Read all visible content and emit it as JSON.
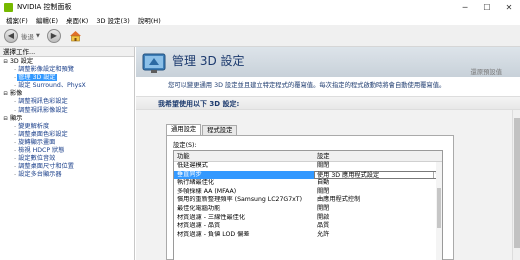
{
  "window": {
    "title": "NVIDIA 控制面板",
    "minimize_glyph": "─",
    "maximize_glyph": "☐",
    "close_glyph": "✕"
  },
  "menu": [
    "檔案(F)",
    "編輯(E)",
    "桌面(K)",
    "3D 設定(3)",
    "說明(H)"
  ],
  "toolbar": {
    "back_label": "後退",
    "back_glyph": "◀",
    "forward_glyph": "▶",
    "caret_glyph": "▼"
  },
  "left_panel": {
    "task_header": "選擇工作...",
    "tree": [
      {
        "type": "category",
        "label": "3D 設定",
        "toggle": "⊟"
      },
      {
        "type": "leaf",
        "label": "調整影像設定和預覽"
      },
      {
        "type": "leaf",
        "label": "管理 3D 設定",
        "selected": true
      },
      {
        "type": "leaf",
        "label": "設定 Surround、PhysX"
      },
      {
        "type": "category",
        "label": "影像",
        "toggle": "⊟"
      },
      {
        "type": "leaf",
        "label": "調整視訊色彩設定"
      },
      {
        "type": "leaf",
        "label": "調整視訊影像設定"
      },
      {
        "type": "category",
        "label": "顯示",
        "toggle": "⊟"
      },
      {
        "type": "leaf",
        "label": "變更解析度"
      },
      {
        "type": "leaf",
        "label": "調整桌面色彩設定"
      },
      {
        "type": "leaf",
        "label": "旋轉顯示畫面"
      },
      {
        "type": "leaf",
        "label": "檢視 HDCP 狀態"
      },
      {
        "type": "leaf",
        "label": "設定數位音效"
      },
      {
        "type": "leaf",
        "label": "調整桌面尺寸和位置"
      },
      {
        "type": "leaf",
        "label": "設定多台顯示器"
      }
    ]
  },
  "content": {
    "page_title": "管理 3D 設定",
    "restore_link": "還原預設值",
    "description": "您可以變更通用 3D 設定並且建立特定程式的覆寫值。每次指定的程式啟動時將會自動使用覆寫值。",
    "section_title": "我希望使用以下 3D 設定:",
    "tabs": [
      {
        "label": "通用設定",
        "active": true
      },
      {
        "label": "程式設定",
        "active": false
      }
    ],
    "settings_label": "設定(S):",
    "columns": {
      "feature": "功能",
      "setting": "設定"
    },
    "rows": [
      {
        "feature": "低延遲模式",
        "value": "關閉"
      },
      {
        "feature": "垂直同步",
        "value": "使用 3D 應用程式設定",
        "selected": true
      },
      {
        "feature": "執行緒最佳化",
        "value": "自動"
      },
      {
        "feature": "多幀採樣 AA (MFAA)",
        "value": "關閉"
      },
      {
        "feature": "慣用的重新整理頻率 (Samsung LC27G7xT)",
        "value": "由應用程式控制"
      },
      {
        "feature": "最佳化電腦功能",
        "value": "開閉"
      },
      {
        "feature": "材質過濾 - 三線性最佳化",
        "value": "開啟"
      },
      {
        "feature": "材質過濾 - 品質",
        "value": "品質"
      },
      {
        "feature": "材質過濾 - 負値 LOD 偏差",
        "value": "允許"
      }
    ],
    "dropdown_arrow": "▼"
  }
}
